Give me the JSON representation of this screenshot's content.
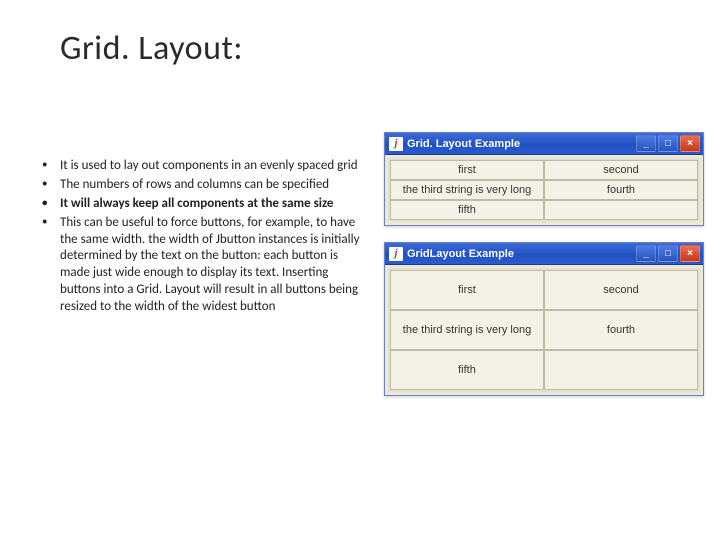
{
  "title": "Grid. Layout:",
  "bullets": [
    "It is used to lay out components in an evenly spaced grid",
    "The numbers of rows and columns can be specified",
    "It will always keep all components at the same size",
    "This can be useful to force buttons, for example, to have the same width. the width of Jbutton instances is initially determined by the text on the button: each button is made just wide enough to display its text. Inserting buttons into a Grid. Layout will result in all buttons being resized to the width of the widest button"
  ],
  "window_small": {
    "title": "Grid. Layout Example",
    "cells": [
      "first",
      "second",
      "the third string is very long",
      "fourth",
      "fifth",
      ""
    ]
  },
  "window_big": {
    "title": "GridLayout Example",
    "cells": [
      "first",
      "second",
      "the third string is very long",
      "fourth",
      "fifth",
      ""
    ]
  },
  "winbtns": {
    "min": "_",
    "max": "□",
    "close": "×"
  }
}
